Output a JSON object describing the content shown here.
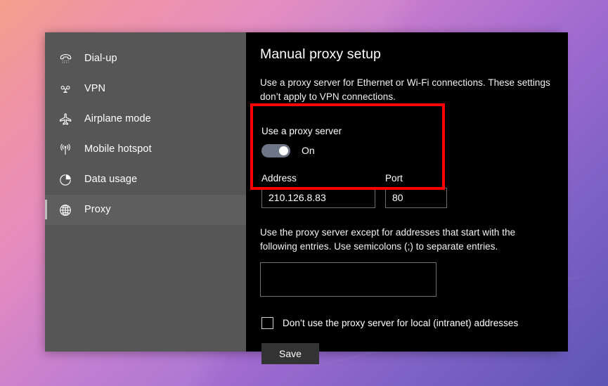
{
  "desktop": {
    "wallpaper_colors": [
      "#f4a08c",
      "#e588bd",
      "#9f6ad0",
      "#5d55b4"
    ]
  },
  "sidebar": {
    "items": [
      {
        "label": "Dial-up",
        "icon": "telephone-icon",
        "selected": false
      },
      {
        "label": "VPN",
        "icon": "vpn-icon",
        "selected": false
      },
      {
        "label": "Airplane mode",
        "icon": "airplane-icon",
        "selected": false
      },
      {
        "label": "Mobile hotspot",
        "icon": "hotspot-icon",
        "selected": false
      },
      {
        "label": "Data usage",
        "icon": "pie-chart-icon",
        "selected": false
      },
      {
        "label": "Proxy",
        "icon": "globe-icon",
        "selected": true
      }
    ]
  },
  "main": {
    "title": "Manual proxy setup",
    "description": "Use a proxy server for Ethernet or Wi-Fi connections. These settings don’t apply to VPN connections.",
    "proxy_toggle": {
      "label": "Use a proxy server",
      "state": "On"
    },
    "address": {
      "label": "Address",
      "value": "210.126.8.83",
      "placeholder": ""
    },
    "port": {
      "label": "Port",
      "value": "80",
      "placeholder": ""
    },
    "exceptions": {
      "description": "Use the proxy server except for addresses that start with the following entries. Use semicolons (;) to separate entries.",
      "value": "",
      "placeholder": ""
    },
    "local_bypass": {
      "label": "Don’t use the proxy server for local (intranet) addresses",
      "checked": false
    },
    "save_label": "Save"
  },
  "annotation": {
    "highlight_color": "#fe0000"
  }
}
